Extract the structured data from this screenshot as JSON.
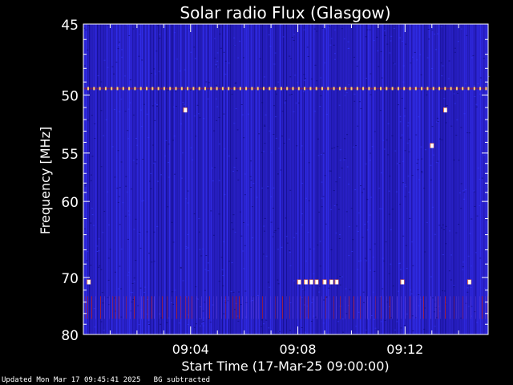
{
  "chart_data": {
    "type": "heatmap",
    "title": "Solar radio Flux (Glasgow)",
    "ylabel": "Frequency [MHz]",
    "xlabel": "Start Time (17-Mar-25 09:00:00)",
    "y_scale": "reciprocal",
    "ylim": [
      45,
      80
    ],
    "y_ticks": [
      45,
      50,
      55,
      60,
      70,
      80
    ],
    "xlim_minutes": [
      0,
      15.1
    ],
    "x_ticks": [
      {
        "minute": 4,
        "label": "09:04"
      },
      {
        "minute": 8,
        "label": "09:08"
      },
      {
        "minute": 12,
        "label": "09:12"
      }
    ],
    "colormap": "blue-red-yellow-white",
    "colors": {
      "background": "#2a20c8",
      "low": "#0a0870",
      "mid": "#3438ff",
      "high_red": "#c02020",
      "hot": "#ffffff",
      "axis": "#ffffff",
      "page": "#000000"
    },
    "features": {
      "constant_line_mhz": 49.5,
      "interference_band_mhz": [
        73,
        77
      ],
      "bursts": [
        {
          "minute": 3.8,
          "mhz": 51.2
        },
        {
          "minute": 13.0,
          "mhz": 54.3
        },
        {
          "minute": 13.5,
          "mhz": 51.2
        },
        {
          "minute": 0.2,
          "mhz": 70.7
        },
        {
          "minute": 8.05,
          "mhz": 70.7
        },
        {
          "minute": 8.3,
          "mhz": 70.7
        },
        {
          "minute": 8.5,
          "mhz": 70.7
        },
        {
          "minute": 8.7,
          "mhz": 70.7
        },
        {
          "minute": 9.0,
          "mhz": 70.7
        },
        {
          "minute": 9.25,
          "mhz": 70.7
        },
        {
          "minute": 9.45,
          "mhz": 70.7
        },
        {
          "minute": 11.9,
          "mhz": 70.7
        },
        {
          "minute": 14.4,
          "mhz": 70.7
        }
      ]
    }
  },
  "footer": {
    "updated": "Updated Mon Mar 17 09:45:41 2025",
    "bg_note": "BG subtracted"
  }
}
